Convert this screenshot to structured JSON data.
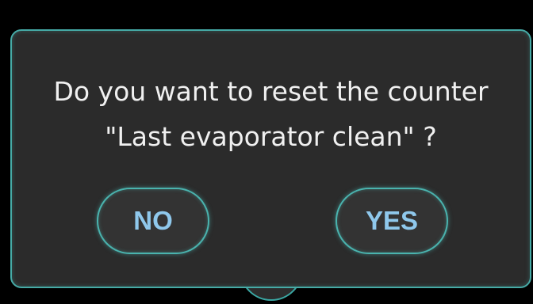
{
  "dialog": {
    "message_line1": "Do you want to reset the counter",
    "message_line2": "\"Last evaporator clean\" ?",
    "no_label": "NO",
    "yes_label": "YES"
  },
  "colors": {
    "background": "#000000",
    "dialog_background": "#2b2b2b",
    "border_accent": "#46aaa6",
    "button_text": "#8fc8ec",
    "message_text": "#f0f0f0"
  }
}
